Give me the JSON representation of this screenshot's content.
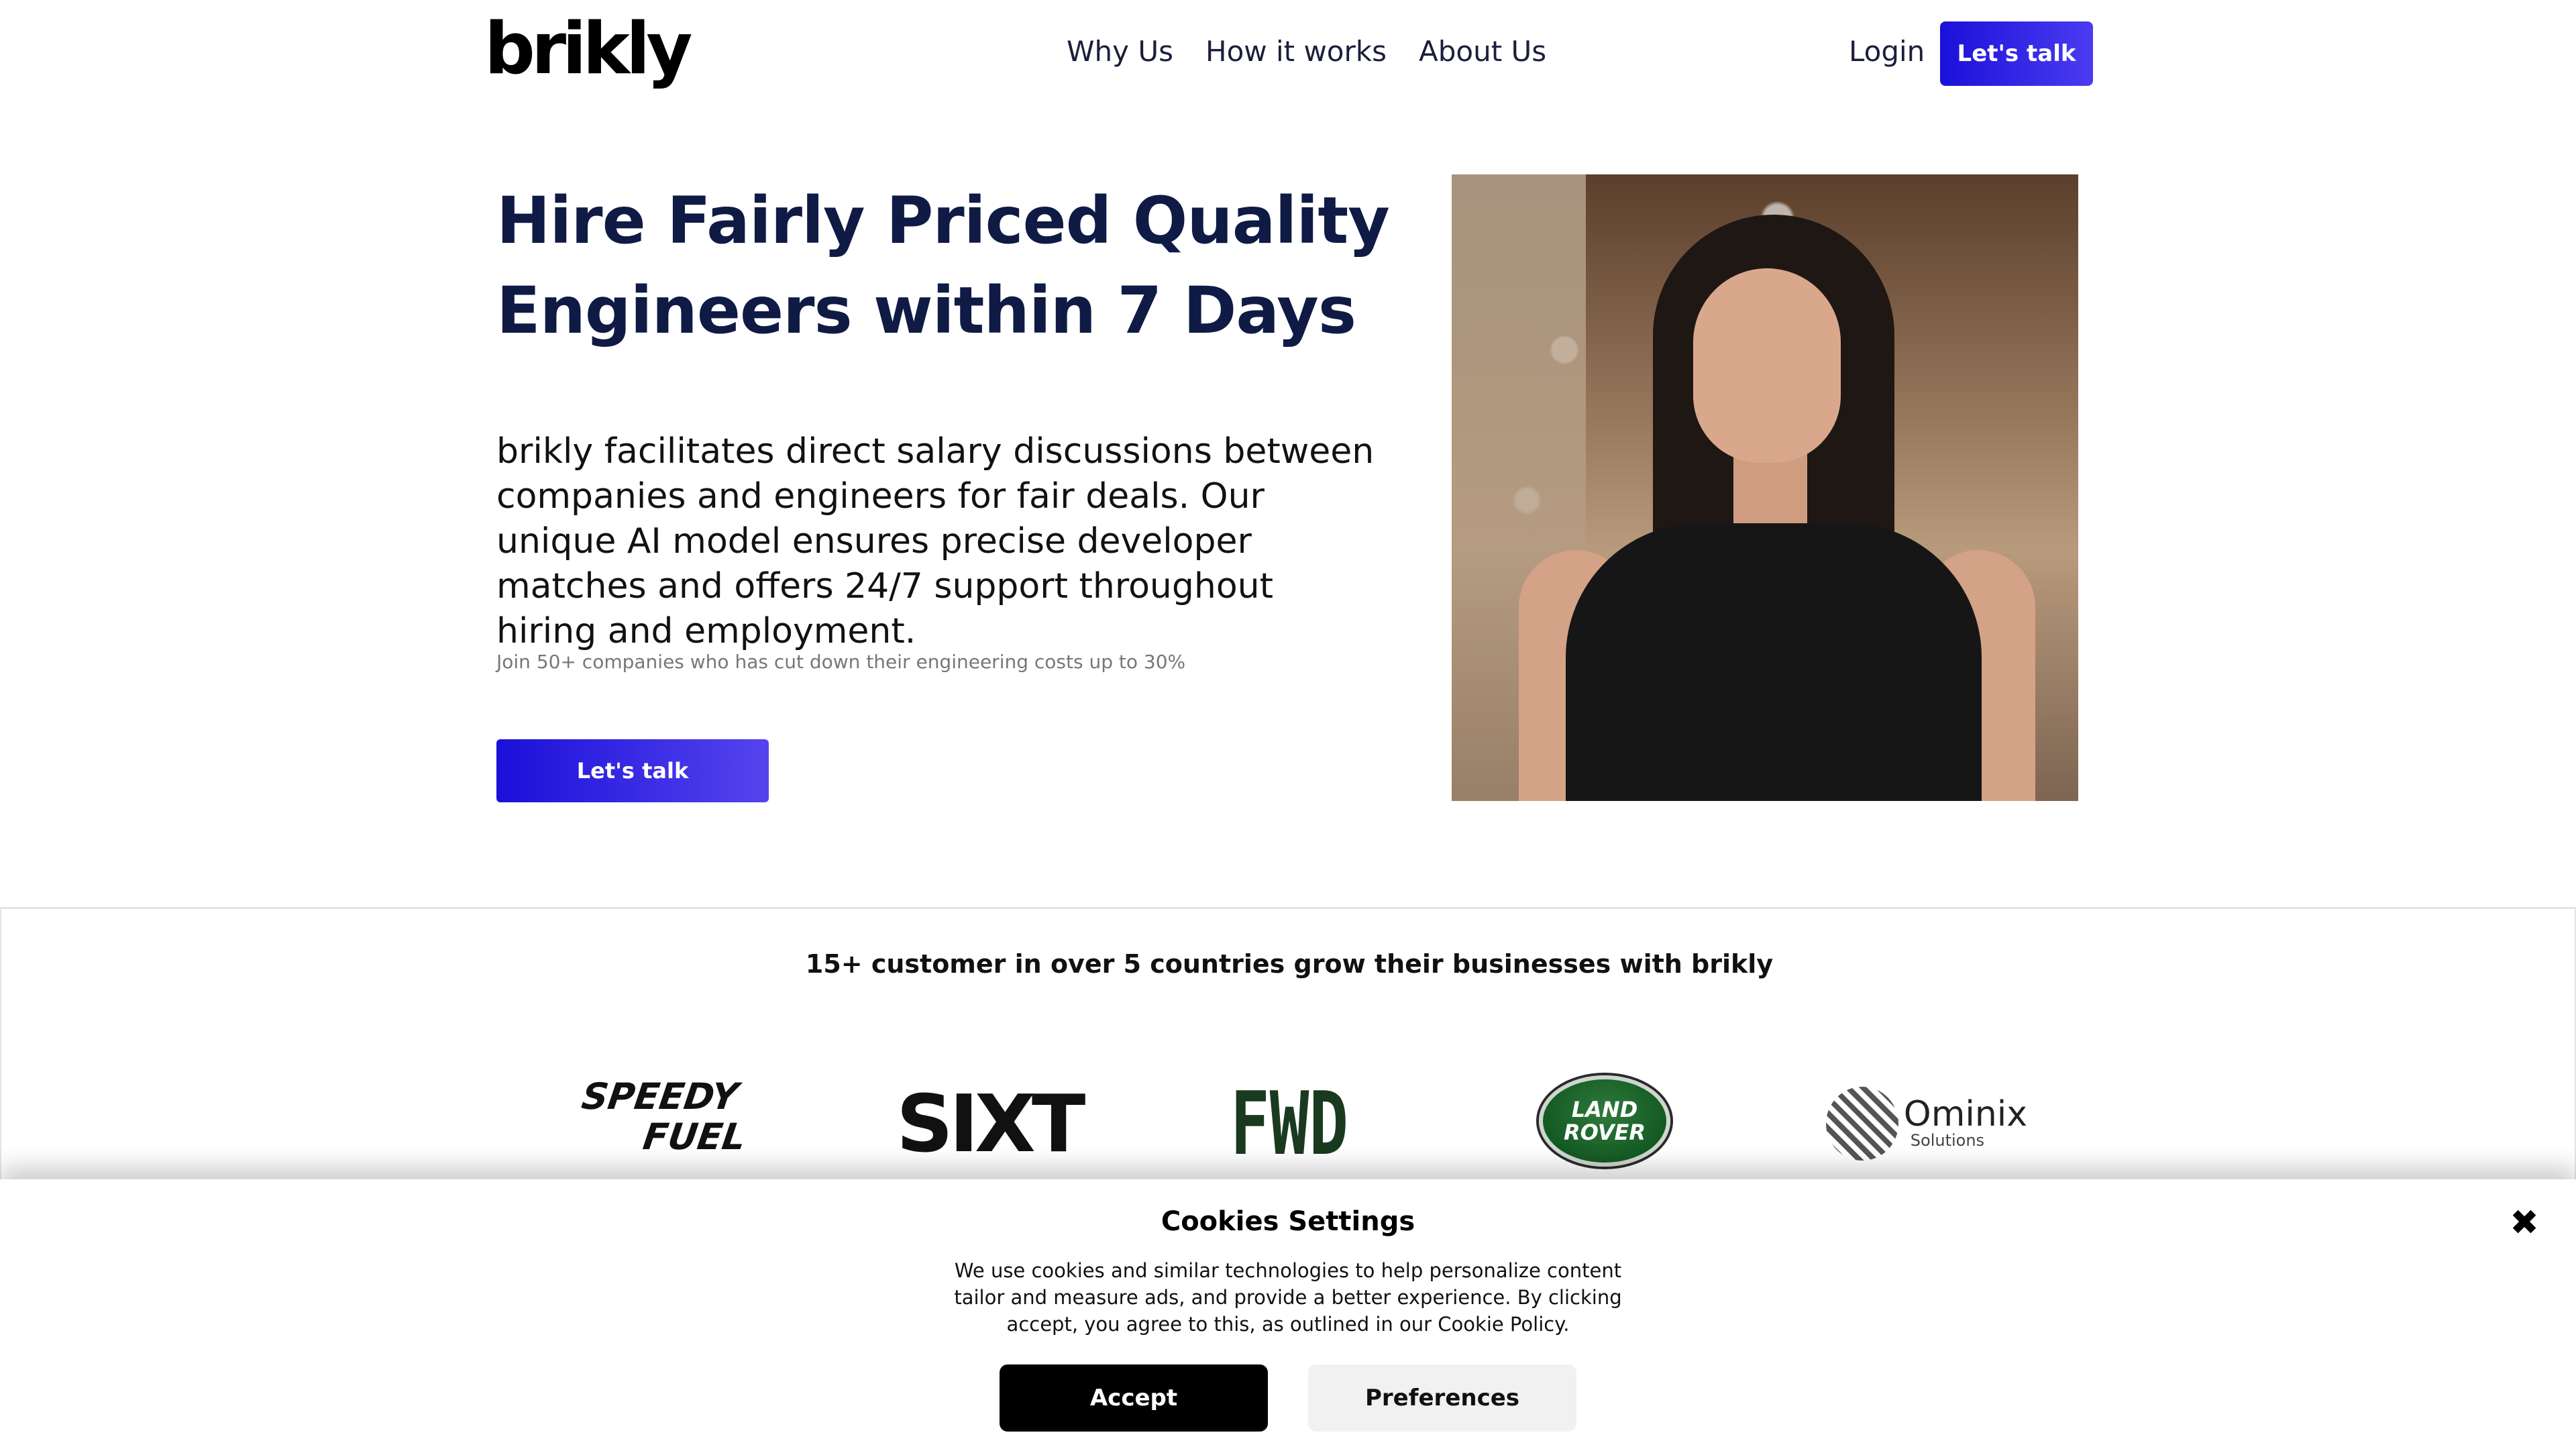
{
  "header": {
    "logo_text": "brikly",
    "nav": [
      {
        "label": "Why Us"
      },
      {
        "label": "How it works"
      },
      {
        "label": "About Us"
      }
    ],
    "login_label": "Login",
    "cta_label": "Let's talk",
    "accent_color": "#3a66ff"
  },
  "hero": {
    "title_line1": "Hire Fairly Priced Quality",
    "title_line2": "Engineers within 7 Days",
    "description": "brikly facilitates direct salary discussions between companies and engineers for fair deals. Our unique AI model ensures precise developer matches and offers 24/7 support throughout hiring and employment.",
    "note": "Join 50+ companies who has cut down their engineering costs up to 30%",
    "cta_label": "Let's talk",
    "title_color": "#0f1a45",
    "button_color": "#1b10d9"
  },
  "customers": {
    "title": "15+ customer in over 5 countries grow their businesses with brikly",
    "logos": {
      "speedy_line1": "SPEEDY",
      "speedy_line2": "FUEL",
      "sixt": "SIXT",
      "fwd": "FWD",
      "landrover_line1": "LAND",
      "landrover_line2": "ROVER",
      "ominix_name": "Ominix",
      "ominix_sub": "Solutions"
    }
  },
  "cookie": {
    "title": "Cookies Settings",
    "text": "We use cookies and  similar technologies to help personalize  content tailor and measure ads, and provide a better experience. By clicking accept, you agree to this, as outlined in our Cookie Policy.",
    "close_glyph": "✖",
    "accept_label": "Accept",
    "preferences_label": "Preferences"
  }
}
